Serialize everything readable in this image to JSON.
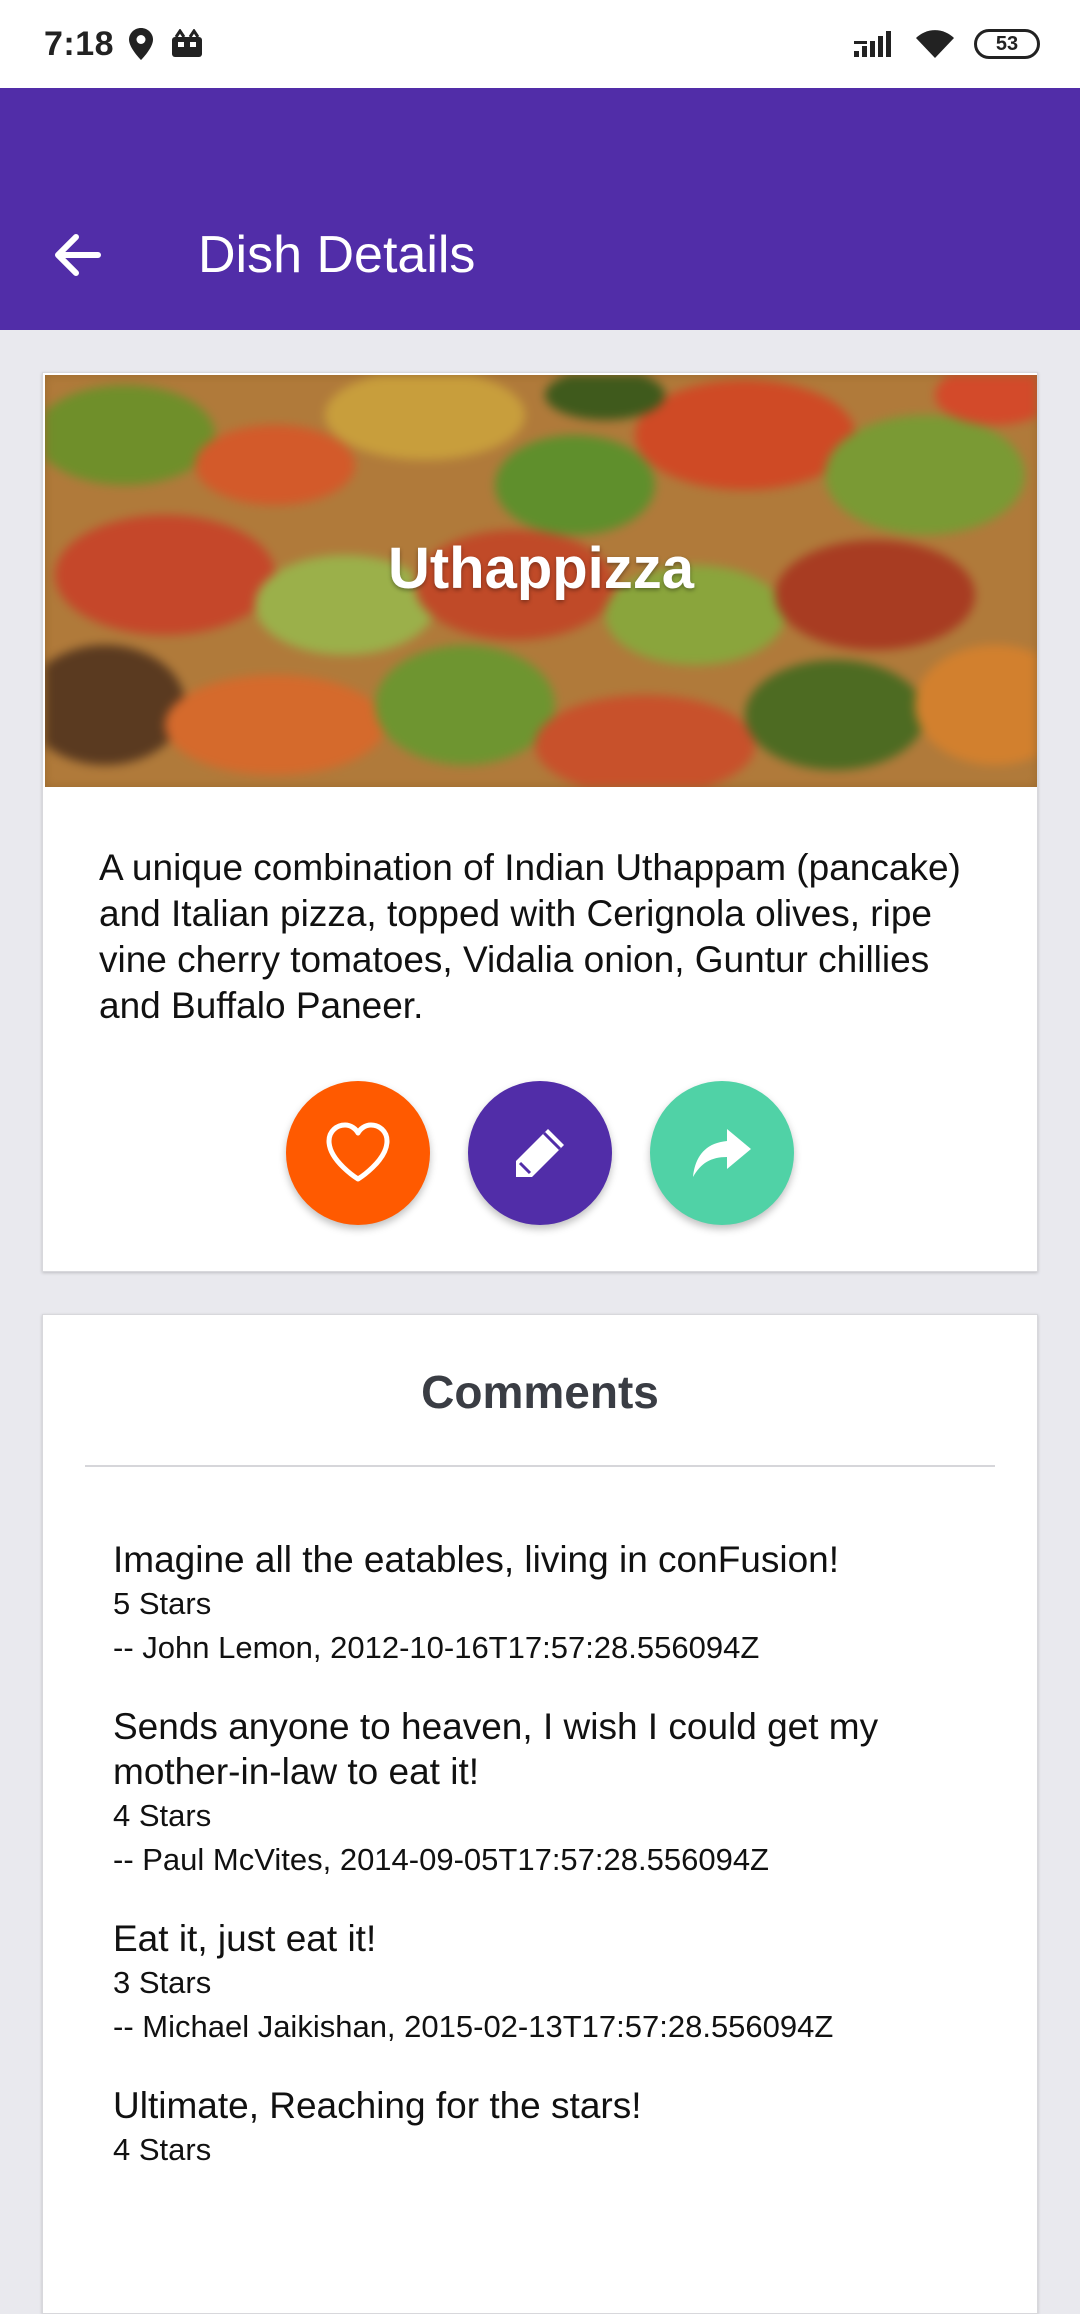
{
  "status_bar": {
    "time": "7:18",
    "battery": "53"
  },
  "app_bar": {
    "title": "Dish Details"
  },
  "dish": {
    "name": "Uthappizza",
    "description": "A unique combination of Indian Uthappam (pancake) and Italian pizza, topped with Cerignola olives, ripe vine cherry tomatoes, Vidalia onion, Guntur chillies and Buffalo Paneer.",
    "actions": {
      "favorite_icon": "heart-outline-icon",
      "favorite_color": "#ff5a00",
      "comment_icon": "pencil-icon",
      "comment_color": "#512da8",
      "share_icon": "share-icon",
      "share_color": "#50d2a6"
    }
  },
  "comments": {
    "title": "Comments",
    "items": [
      {
        "text": "Imagine all the eatables, living in conFusion!",
        "rating": "5 Stars",
        "author": "-- John Lemon, 2012-10-16T17:57:28.556094Z"
      },
      {
        "text": "Sends anyone to heaven, I wish I could get my mother-in-law to eat it!",
        "rating": "4 Stars",
        "author": "-- Paul McVites, 2014-09-05T17:57:28.556094Z"
      },
      {
        "text": "Eat it, just eat it!",
        "rating": "3 Stars",
        "author": "-- Michael Jaikishan, 2015-02-13T17:57:28.556094Z"
      },
      {
        "text": "Ultimate, Reaching for the stars!",
        "rating": "4 Stars",
        "author": ""
      }
    ]
  },
  "theme": {
    "primary": "#512da8",
    "background": "#e9e9ee"
  }
}
